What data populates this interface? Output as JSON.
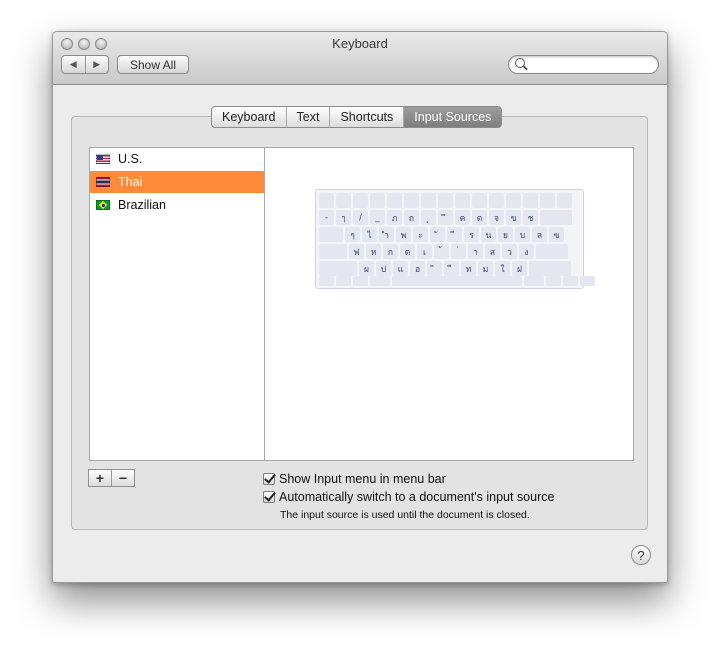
{
  "window": {
    "title": "Keyboard"
  },
  "toolbar": {
    "back_glyph": "◀",
    "forward_glyph": "▶",
    "show_all_label": "Show All",
    "search_value": "",
    "search_placeholder": ""
  },
  "tabs": [
    {
      "label": "Keyboard",
      "active": false
    },
    {
      "label": "Text",
      "active": false
    },
    {
      "label": "Shortcuts",
      "active": false
    },
    {
      "label": "Input Sources",
      "active": true
    }
  ],
  "input_sources": [
    {
      "label": "U.S.",
      "flag": "us-flag-icon",
      "selected": false
    },
    {
      "label": "Thai",
      "flag": "thai-flag-icon",
      "selected": true
    },
    {
      "label": "Brazilian",
      "flag": "brazil-flag-icon",
      "selected": false
    }
  ],
  "keyboard_preview": {
    "rows": [
      [
        "-",
        "ๅ",
        "/",
        "_",
        "ภ",
        "ถ",
        "ุ",
        "ึ",
        "ค",
        "ต",
        "จ",
        "ข",
        "ช"
      ],
      [
        "ๆ",
        "ไ",
        "ำ",
        "พ",
        "ะ",
        "ั",
        "ี",
        "ร",
        "น",
        "ย",
        "บ",
        "ล",
        "ฃ"
      ],
      [
        "ฟ",
        "ห",
        "ก",
        "ด",
        "เ",
        "้",
        "่",
        "า",
        "ส",
        "ว",
        "ง"
      ],
      [
        "ผ",
        "ป",
        "แ",
        "อ",
        "ิ",
        "ื",
        "ท",
        "ม",
        "ใ",
        "ฝ"
      ]
    ]
  },
  "list_buttons": {
    "add": "+",
    "remove": "−"
  },
  "options": {
    "show_menu": {
      "label": "Show Input menu in menu bar",
      "checked": true
    },
    "auto_switch": {
      "label": "Automatically switch to a document's input source",
      "checked": true
    },
    "note": "The input source is used until the document is closed."
  },
  "help": {
    "label": "?"
  }
}
